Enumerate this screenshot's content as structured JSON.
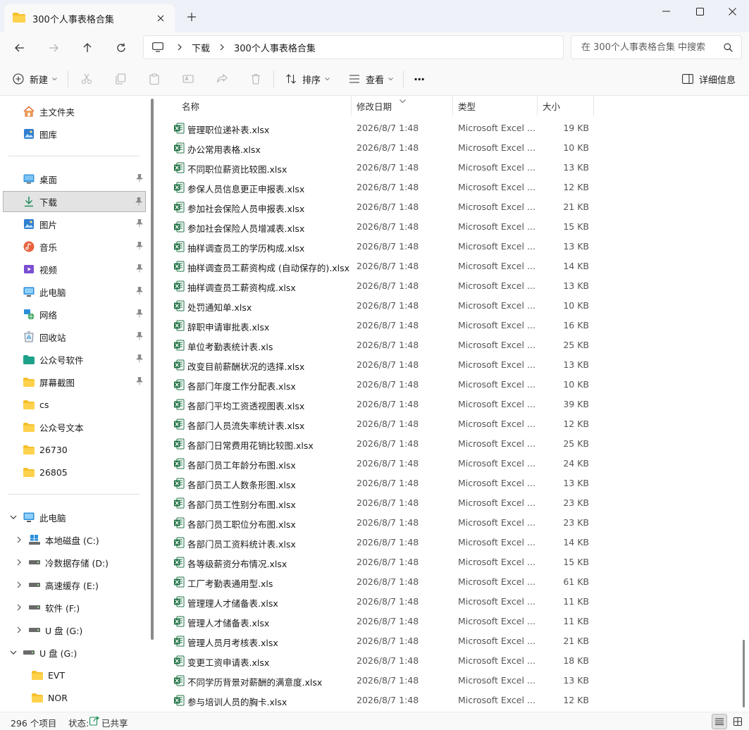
{
  "window": {
    "tab_title": "300个人事表格合集"
  },
  "address_bar": {
    "breadcrumbs": [
      "下载",
      "300个人事表格合集"
    ],
    "search_placeholder": "在 300个人事表格合集 中搜索"
  },
  "toolbar": {
    "new_label": "新建",
    "sort_label": "排序",
    "view_label": "查看",
    "more_label": "···",
    "details_label": "详细信息"
  },
  "sidebar": {
    "quick": [
      {
        "label": "主文件夹",
        "icon": "home-icon"
      },
      {
        "label": "图库",
        "icon": "gallery-icon"
      }
    ],
    "pinned": [
      {
        "label": "桌面",
        "icon": "desktop-icon"
      },
      {
        "label": "下载",
        "icon": "download-icon"
      },
      {
        "label": "图片",
        "icon": "pictures-icon"
      },
      {
        "label": "音乐",
        "icon": "music-icon"
      },
      {
        "label": "视频",
        "icon": "video-icon"
      },
      {
        "label": "此电脑",
        "icon": "computer-icon"
      },
      {
        "label": "网络",
        "icon": "network-icon"
      },
      {
        "label": "回收站",
        "icon": "recycle-bin-icon"
      },
      {
        "label": "公众号软件",
        "icon": "folder-icon"
      },
      {
        "label": "屏幕截图",
        "icon": "folder-icon"
      }
    ],
    "folders": [
      {
        "label": "cs"
      },
      {
        "label": "公众号文本"
      },
      {
        "label": "26730"
      },
      {
        "label": "26805"
      }
    ],
    "tree_root": "此电脑",
    "drives": [
      {
        "label": "本地磁盘 (C:)"
      },
      {
        "label": "冷数据存储 (D:)"
      },
      {
        "label": "高速缓存 (E:)"
      },
      {
        "label": "软件 (F:)"
      },
      {
        "label": "U 盘 (G:)"
      }
    ],
    "usb_root": "U 盘 (G:)",
    "usb_folders": [
      {
        "label": "EVT"
      },
      {
        "label": "NOR"
      }
    ]
  },
  "columns": {
    "name": "名称",
    "date": "修改日期",
    "type": "类型",
    "size": "大小"
  },
  "files": [
    {
      "name": "管理职位递补表.xlsx",
      "date": "2026/8/7 1:48",
      "type": "Microsoft Excel ...",
      "size": "19 KB"
    },
    {
      "name": "办公常用表格.xlsx",
      "date": "2026/8/7 1:48",
      "type": "Microsoft Excel ...",
      "size": "10 KB"
    },
    {
      "name": "不同职位薪资比较图.xlsx",
      "date": "2026/8/7 1:48",
      "type": "Microsoft Excel ...",
      "size": "13 KB"
    },
    {
      "name": "参保人员信息更正申报表.xlsx",
      "date": "2026/8/7 1:48",
      "type": "Microsoft Excel ...",
      "size": "12 KB"
    },
    {
      "name": "参加社会保险人员申报表.xlsx",
      "date": "2026/8/7 1:48",
      "type": "Microsoft Excel ...",
      "size": "21 KB"
    },
    {
      "name": "参加社会保险人员增减表.xlsx",
      "date": "2026/8/7 1:48",
      "type": "Microsoft Excel ...",
      "size": "15 KB"
    },
    {
      "name": "抽样调查员工的学历构成.xlsx",
      "date": "2026/8/7 1:48",
      "type": "Microsoft Excel ...",
      "size": "13 KB"
    },
    {
      "name": "抽样调查员工薪资构成 (自动保存的).xlsx",
      "date": "2026/8/7 1:48",
      "type": "Microsoft Excel ...",
      "size": "14 KB"
    },
    {
      "name": "抽样调查员工薪资构成.xlsx",
      "date": "2026/8/7 1:48",
      "type": "Microsoft Excel ...",
      "size": "13 KB"
    },
    {
      "name": "处罚通知单.xlsx",
      "date": "2026/8/7 1:48",
      "type": "Microsoft Excel ...",
      "size": "10 KB"
    },
    {
      "name": "辞职申请审批表.xlsx",
      "date": "2026/8/7 1:48",
      "type": "Microsoft Excel ...",
      "size": "16 KB"
    },
    {
      "name": "单位考勤表统计表.xls",
      "date": "2026/8/7 1:48",
      "type": "Microsoft Excel ...",
      "size": "25 KB"
    },
    {
      "name": "改变目前薪酬状况的选择.xlsx",
      "date": "2026/8/7 1:48",
      "type": "Microsoft Excel ...",
      "size": "13 KB"
    },
    {
      "name": "各部门年度工作分配表.xlsx",
      "date": "2026/8/7 1:48",
      "type": "Microsoft Excel ...",
      "size": "10 KB"
    },
    {
      "name": "各部门平均工资透视图表.xlsx",
      "date": "2026/8/7 1:48",
      "type": "Microsoft Excel ...",
      "size": "39 KB"
    },
    {
      "name": "各部门人员流失率统计表.xlsx",
      "date": "2026/8/7 1:48",
      "type": "Microsoft Excel ...",
      "size": "12 KB"
    },
    {
      "name": "各部门日常费用花销比较图.xlsx",
      "date": "2026/8/7 1:48",
      "type": "Microsoft Excel ...",
      "size": "25 KB"
    },
    {
      "name": "各部门员工年龄分布图.xlsx",
      "date": "2026/8/7 1:48",
      "type": "Microsoft Excel ...",
      "size": "24 KB"
    },
    {
      "name": "各部门员工人数条形图.xlsx",
      "date": "2026/8/7 1:48",
      "type": "Microsoft Excel ...",
      "size": "13 KB"
    },
    {
      "name": "各部门员工性别分布图.xlsx",
      "date": "2026/8/7 1:48",
      "type": "Microsoft Excel ...",
      "size": "23 KB"
    },
    {
      "name": "各部门员工职位分布图.xlsx",
      "date": "2026/8/7 1:48",
      "type": "Microsoft Excel ...",
      "size": "23 KB"
    },
    {
      "name": "各部门员工资料统计表.xlsx",
      "date": "2026/8/7 1:48",
      "type": "Microsoft Excel ...",
      "size": "14 KB"
    },
    {
      "name": "各等级薪资分布情况.xlsx",
      "date": "2026/8/7 1:48",
      "type": "Microsoft Excel ...",
      "size": "15 KB"
    },
    {
      "name": "工厂考勤表通用型.xls",
      "date": "2026/8/7 1:48",
      "type": "Microsoft Excel ...",
      "size": "61 KB"
    },
    {
      "name": "管理理人才储备表.xlsx",
      "date": "2026/8/7 1:48",
      "type": "Microsoft Excel ...",
      "size": "11 KB"
    },
    {
      "name": "管理人才储备表.xlsx",
      "date": "2026/8/7 1:48",
      "type": "Microsoft Excel ...",
      "size": "11 KB"
    },
    {
      "name": "管理人员月考核表.xlsx",
      "date": "2026/8/7 1:48",
      "type": "Microsoft Excel ...",
      "size": "21 KB"
    },
    {
      "name": "变更工资申请表.xlsx",
      "date": "2026/8/7 1:48",
      "type": "Microsoft Excel ...",
      "size": "18 KB"
    },
    {
      "name": "不同学历背景对薪酬的满意度.xlsx",
      "date": "2026/8/7 1:48",
      "type": "Microsoft Excel ...",
      "size": "13 KB"
    },
    {
      "name": "参与培训人员的胸卡.xlsx",
      "date": "2026/8/7 1:48",
      "type": "Microsoft Excel ...",
      "size": "12 KB"
    }
  ],
  "status": {
    "count": "296 个项目",
    "state_label": "状态:",
    "shared": "已共享"
  },
  "colors": {
    "excel_green": "#1f7244",
    "folder_yellow": "#f5c02b",
    "accent_blue": "#0067c0"
  }
}
